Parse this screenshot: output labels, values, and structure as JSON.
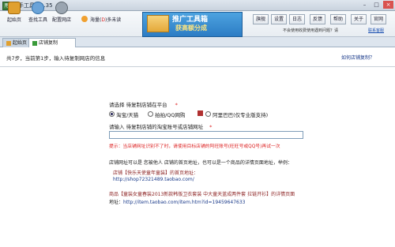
{
  "app": {
    "title": "甩手工具箱1.35"
  },
  "window_controls": {
    "min": "–",
    "max": "□",
    "close": "×"
  },
  "toolbar": {
    "home": "起始页",
    "find_tools": "查找工具",
    "config_shop": "配置网店",
    "user_name": "海量(",
    "user_mid": "D",
    "user_rest": ")多未读"
  },
  "banner": {
    "line1": "推广工具箱",
    "line2": "获高额分成"
  },
  "right_buttons": [
    "旗舰",
    "设置",
    "日志",
    "反馈",
    "帮助",
    "关于",
    "官网"
  ],
  "notice": {
    "text": "不会使用收费使用遇到问题？请",
    "link": "联系客服"
  },
  "tabs": {
    "home": "起始页",
    "copy": "店铺复制"
  },
  "step": {
    "text": "共7步，当前第1步，输入待复制网店的信息",
    "howto": "如何店铺复制？"
  },
  "form": {
    "platform_label": "请选择 待复制店铺在平台",
    "required_mark": "*",
    "options": [
      "淘宝/天猫",
      "拍拍/QQ网购",
      "阿里巴巴(仅专业版支持)"
    ],
    "selected_option": "淘宝/天猫",
    "url_label": "请输入 待复制店铺的淘宝账号或店铺网址",
    "url_value": "",
    "hint": "提示：当店铺网址识别不了时，请使用目标店铺的阿旺账号(旺旺号或QQ号)再试一次",
    "desc": "店铺网址可以是 您被他人 店铺的首页地址，也可以是一个商品的详情页面地址，举例：",
    "example1_title": "店铺【快乐天使童年童装】的首页地址：",
    "example1_url": "http://shop72321489.taobao.com/",
    "example2_title": "商品【童装女童春装2013新款韩版卫衣套装 中大童天蓝成两件套 拉链开衫】的详情页面",
    "example2_prefix": "地址：",
    "example2_url": "http://item.taobao.com/item.htm?id=19459647633"
  }
}
